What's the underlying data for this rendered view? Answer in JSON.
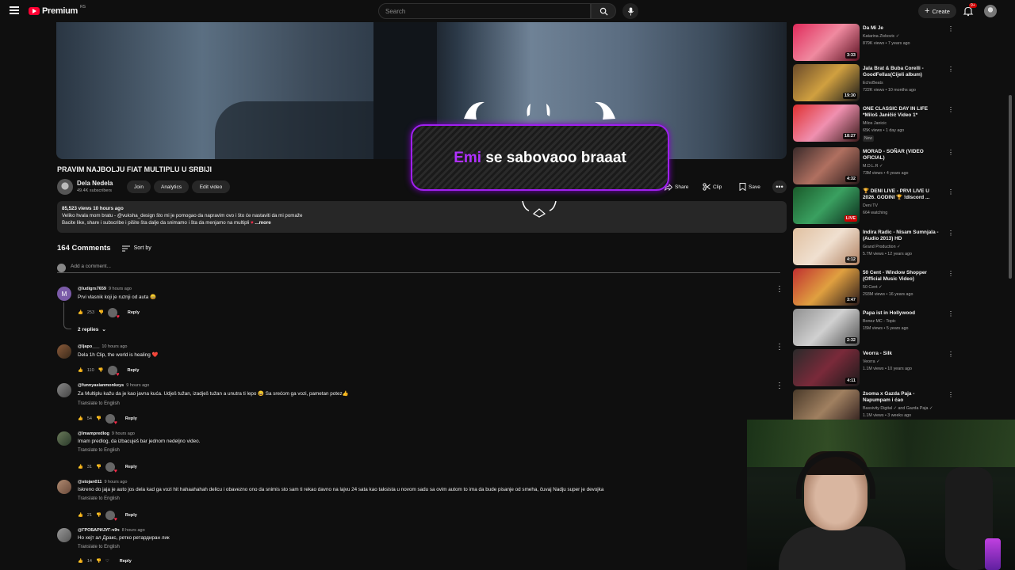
{
  "topbar": {
    "logo_text": "Premium",
    "logo_region": "RS",
    "search_placeholder": "Search",
    "create_label": "Create",
    "notif_count": "9+"
  },
  "video": {
    "title": "PRAVIM NAJBOLJU FIAT MULTIPLU U SRBIJI",
    "channel": "Dela Nedela",
    "subscribers": "49.4K subscribers",
    "buttons": {
      "join": "Join",
      "analytics": "Analytics",
      "edit": "Edit video",
      "share": "Share",
      "clip": "Clip",
      "save": "Save"
    },
    "description": {
      "meta": "85,523 views  10 hours ago",
      "line1": "Veliko hvala mom bratu - @vuksha_design što mi je pomogao da napravim ovo i što će nastaviti da mi pomaže",
      "line2": "Bacite like, share i subscribe i pišite šta dalje da snimamo i šta da menjamo na multipli ",
      "more": "...more"
    }
  },
  "overlay": {
    "highlight": "Emi",
    "text": " se sabovaoo braaat"
  },
  "comments": {
    "count_label": "164 Comments",
    "sort_label": "Sort by",
    "add_placeholder": "Add a comment...",
    "replies_label": "2 replies",
    "items": [
      {
        "author": "@ludigrs7659",
        "time": "9 hours ago",
        "text": "Prvi vlasnik koji je ruznji od auta 😄",
        "likes": "253",
        "reply": "Reply",
        "avatar_letter": "M",
        "translate": ""
      },
      {
        "author": "@ljapo___",
        "time": "10 hours ago",
        "text": "Dela 1h Clip, the world is healing ❤️",
        "likes": "110",
        "reply": "Reply",
        "avatar_letter": "",
        "translate": ""
      },
      {
        "author": "@funnyasianmonkeys",
        "time": "9 hours ago",
        "text": "Za Multiplu kažu da je kao javna kuća. Udješ tužan, izadješ tužan a unutra ti lepo 😄  Sa srećom ga vozi, pametan potez👍",
        "likes": "54",
        "reply": "Reply",
        "avatar_letter": "",
        "translate": "Translate to English"
      },
      {
        "author": "@lmampredlog",
        "time": "9 hours ago",
        "text": "Imam predlog, da izbacuješ bar jednom nedeljno video.",
        "likes": "31",
        "reply": "Reply",
        "avatar_letter": "",
        "translate": "Translate to English"
      },
      {
        "author": "@stojan011",
        "time": "9 hours ago",
        "text": "Iskreno do jaja je auto jos dela kad ga vozi hit hahaahahah delicu i obavezno ono da snimis sto sam ti rekao davno na lajvu 24 sata kao taksista u novom sadu sa ovim autom to ima da bude pisanje od smeha, čuvaj Nadju super je devojka",
        "likes": "21",
        "reply": "Reply",
        "avatar_letter": "",
        "translate": "Translate to English"
      },
      {
        "author": "@ГРОБАРИЈУГ-ч9ч",
        "time": "8 hours ago",
        "text": "Но хејт ал Дракс, ретко ретардиран лик",
        "likes": "14",
        "reply": "Reply",
        "avatar_letter": "",
        "translate": "Translate to English"
      }
    ]
  },
  "sidebar": {
    "items": [
      {
        "title": "Da Mi Je",
        "channel": "Katarina Zivkovic ✓",
        "meta": "879K views • 7 years ago",
        "duration": "3:33",
        "badge": ""
      },
      {
        "title": "Jala Brat & Buba Corelli - GoodFellas(Cijeli album)",
        "channel": "EchoBeats",
        "meta": "722K views • 10 months ago",
        "duration": "19:30",
        "badge": ""
      },
      {
        "title": "ONE CLASSIC DAY IN LIFE *Miloš Janičić Video 1*",
        "channel": "Milos Janicic",
        "meta": "65K views • 1 day ago",
        "duration": "18:27",
        "badge": "New"
      },
      {
        "title": "MORAD - SOÑAR (VIDEO OFICIAL)",
        "channel": "M.D.L.R ✓",
        "meta": "73M views • 4 years ago",
        "duration": "4:32",
        "badge": ""
      },
      {
        "title": "🏆 DENI LIVE - PRVI LIVE U 2026. GODINI 🏆 !discord ...",
        "channel": "Deni TV",
        "meta": "664 watching",
        "duration": "LIVE",
        "badge": ""
      },
      {
        "title": "Indira Radic - Nisam Sumnjala - (Audio 2013) HD",
        "channel": "Grand Production ✓",
        "meta": "5.7M views • 12 years ago",
        "duration": "4:12",
        "badge": ""
      },
      {
        "title": "50 Cent - Window Shopper (Official Music Video)",
        "channel": "50 Cent ✓",
        "meta": "293M views • 16 years ago",
        "duration": "3:47",
        "badge": ""
      },
      {
        "title": "Papa ist in Hollywood",
        "channel": "Bonez MC - Topic",
        "meta": "15M views • 5 years ago",
        "duration": "2:32",
        "badge": ""
      },
      {
        "title": "Veorra - Silk",
        "channel": "Veorra ✓",
        "meta": "1.1M views • 10 years ago",
        "duration": "4:11",
        "badge": ""
      },
      {
        "title": "2soma x Gazda Paja - Napumpam i ćao",
        "channel": "Bassivity Digital ✓ and Gazda Paja ✓",
        "meta": "1.1M views • 3 weeks ago",
        "duration": "",
        "badge": ""
      }
    ]
  },
  "colors": {
    "accent": "#ff0033",
    "overlay_purple": "#a020f0",
    "bg": "#0f0f0f"
  }
}
